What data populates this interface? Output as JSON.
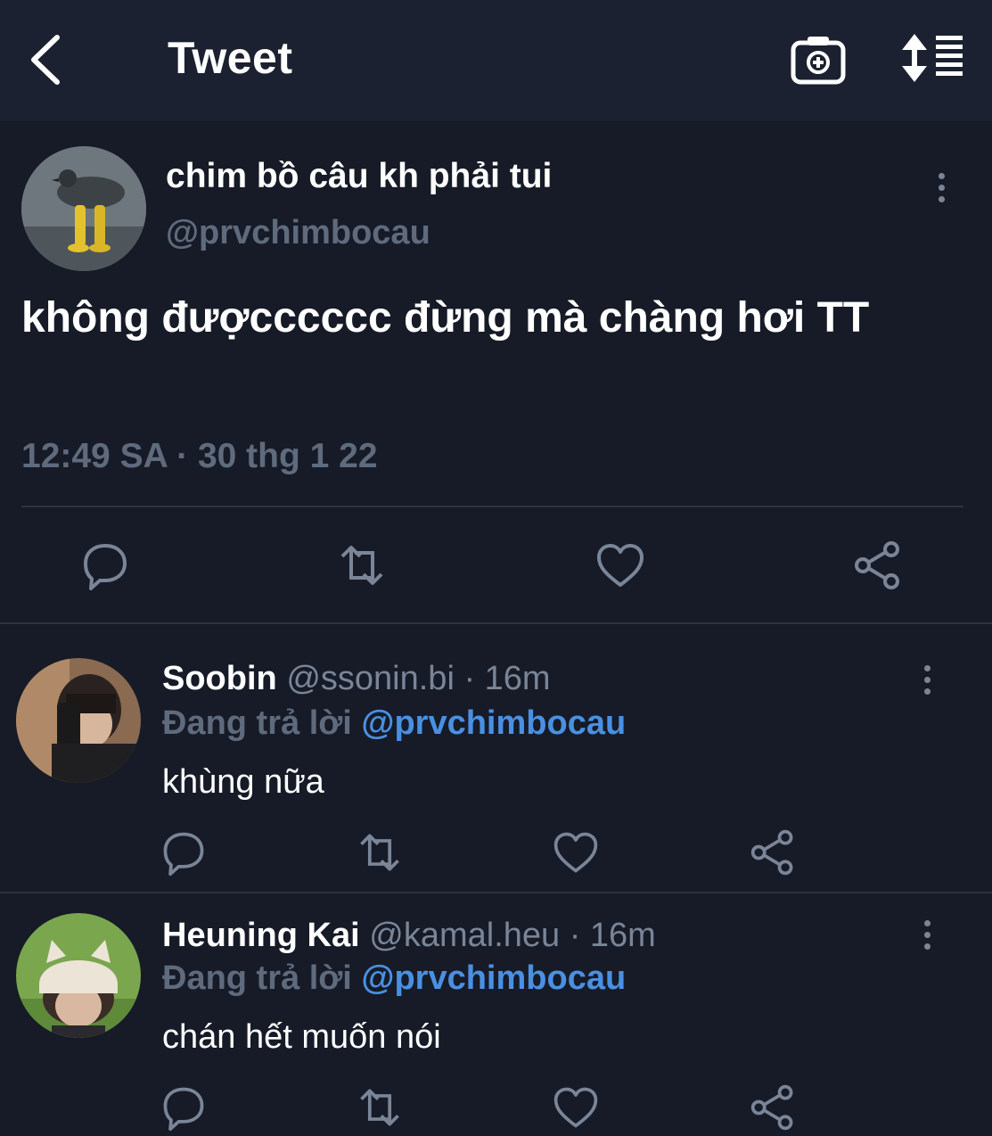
{
  "header": {
    "title": "Tweet",
    "back_icon": "chevron-left-icon",
    "camera_icon": "camera-plus-icon",
    "sort_icon": "sort-icon"
  },
  "main_tweet": {
    "author_name": "chim bồ câu kh phải tui",
    "handle": "@prvchimbocau",
    "text": "không đượcccccc đừng mà chàng hơi TT",
    "timestamp": "12:49 SA · 30 thg 1 22"
  },
  "replies": [
    {
      "name": "Soobin",
      "meta": "@ssonin.bi · 16m",
      "replying_prefix": "Đang trả lời",
      "replying_to": "@prvchimbocau",
      "text": "khùng nữa"
    },
    {
      "name": "Heuning Kai",
      "meta": "@kamal.heu · 16m",
      "replying_prefix": "Đang trả lời",
      "replying_to": "@prvchimbocau",
      "text": "chán hết muốn nói"
    }
  ],
  "colors": {
    "background": "#161b27",
    "header": "#1b2130",
    "muted": "#5f6b7d",
    "mention": "#4a90e2"
  }
}
